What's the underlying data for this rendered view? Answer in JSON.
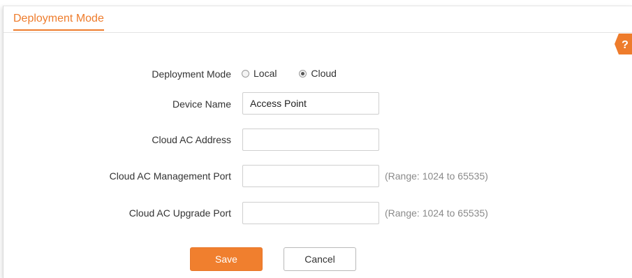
{
  "tab": {
    "title": "Deployment Mode"
  },
  "help": {
    "glyph": "?",
    "color": "#ee7c2c"
  },
  "form": {
    "deployment_mode": {
      "label": "Deployment Mode",
      "options": [
        {
          "label": "Local",
          "selected": false
        },
        {
          "label": "Cloud",
          "selected": true
        }
      ]
    },
    "device_name": {
      "label": "Device Name",
      "value": "Access Point"
    },
    "cloud_ac_address": {
      "label": "Cloud AC Address",
      "value": ""
    },
    "cloud_ac_management_port": {
      "label": "Cloud AC Management Port",
      "value": "",
      "hint": "(Range: 1024 to 65535)"
    },
    "cloud_ac_upgrade_port": {
      "label": "Cloud AC Upgrade Port",
      "value": "",
      "hint": "(Range: 1024 to 65535)"
    }
  },
  "buttons": {
    "save": "Save",
    "cancel": "Cancel"
  },
  "colors": {
    "accent": "#ee7c2c",
    "save_bg": "#f07f2e"
  }
}
